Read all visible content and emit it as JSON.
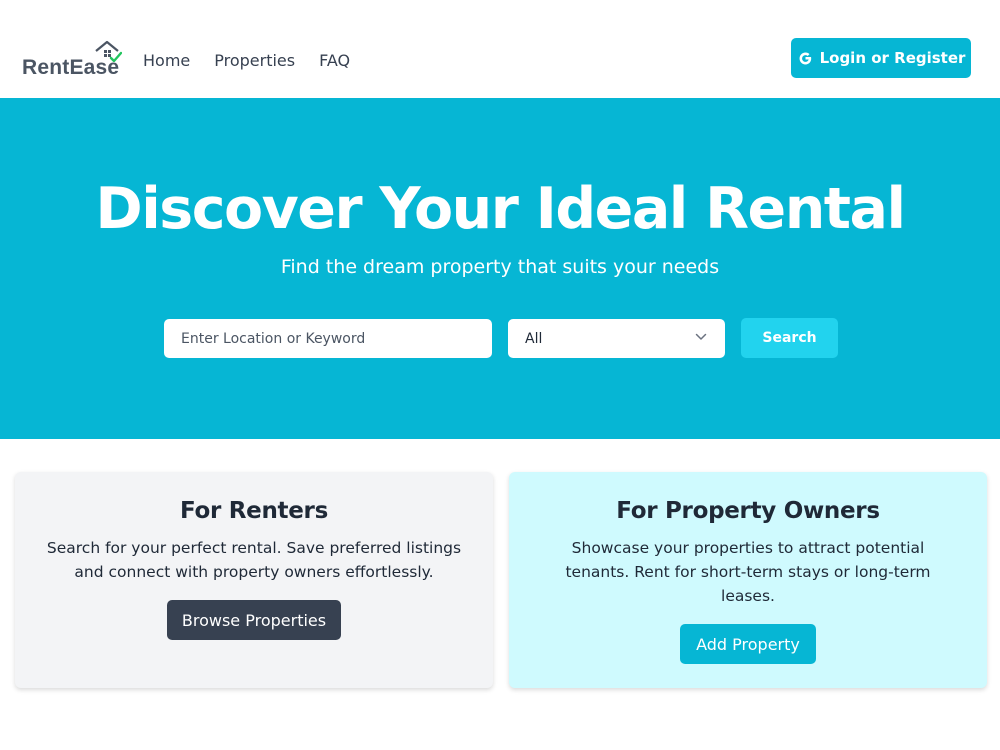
{
  "header": {
    "logo_text": "RentEase",
    "nav": [
      {
        "label": "Home"
      },
      {
        "label": "Properties"
      },
      {
        "label": "FAQ"
      }
    ],
    "login_label": "Login or Register"
  },
  "hero": {
    "title": "Discover Your Ideal Rental",
    "subtitle": "Find the dream property that suits your needs",
    "search_placeholder": "Enter Location or Keyword",
    "filter_selected": "All",
    "search_label": "Search"
  },
  "cards": {
    "renters": {
      "title": "For Renters",
      "description": "Search for your perfect rental. Save preferred listings and connect with property owners effortlessly.",
      "button_label": "Browse Properties"
    },
    "owners": {
      "title": "For Property Owners",
      "description": "Showcase your properties to attract potential tenants. Rent for short-term stays or long-term leases.",
      "button_label": "Add Property"
    }
  },
  "colors": {
    "brand": "#06b6d4",
    "search_button": "#22d3ee",
    "dark_button": "#374151",
    "owners_card_bg": "#cffafe",
    "renters_card_bg": "#f3f4f6"
  },
  "icons": {
    "logo": "house-icon",
    "login": "google-g-icon",
    "select": "chevron-down-icon"
  }
}
